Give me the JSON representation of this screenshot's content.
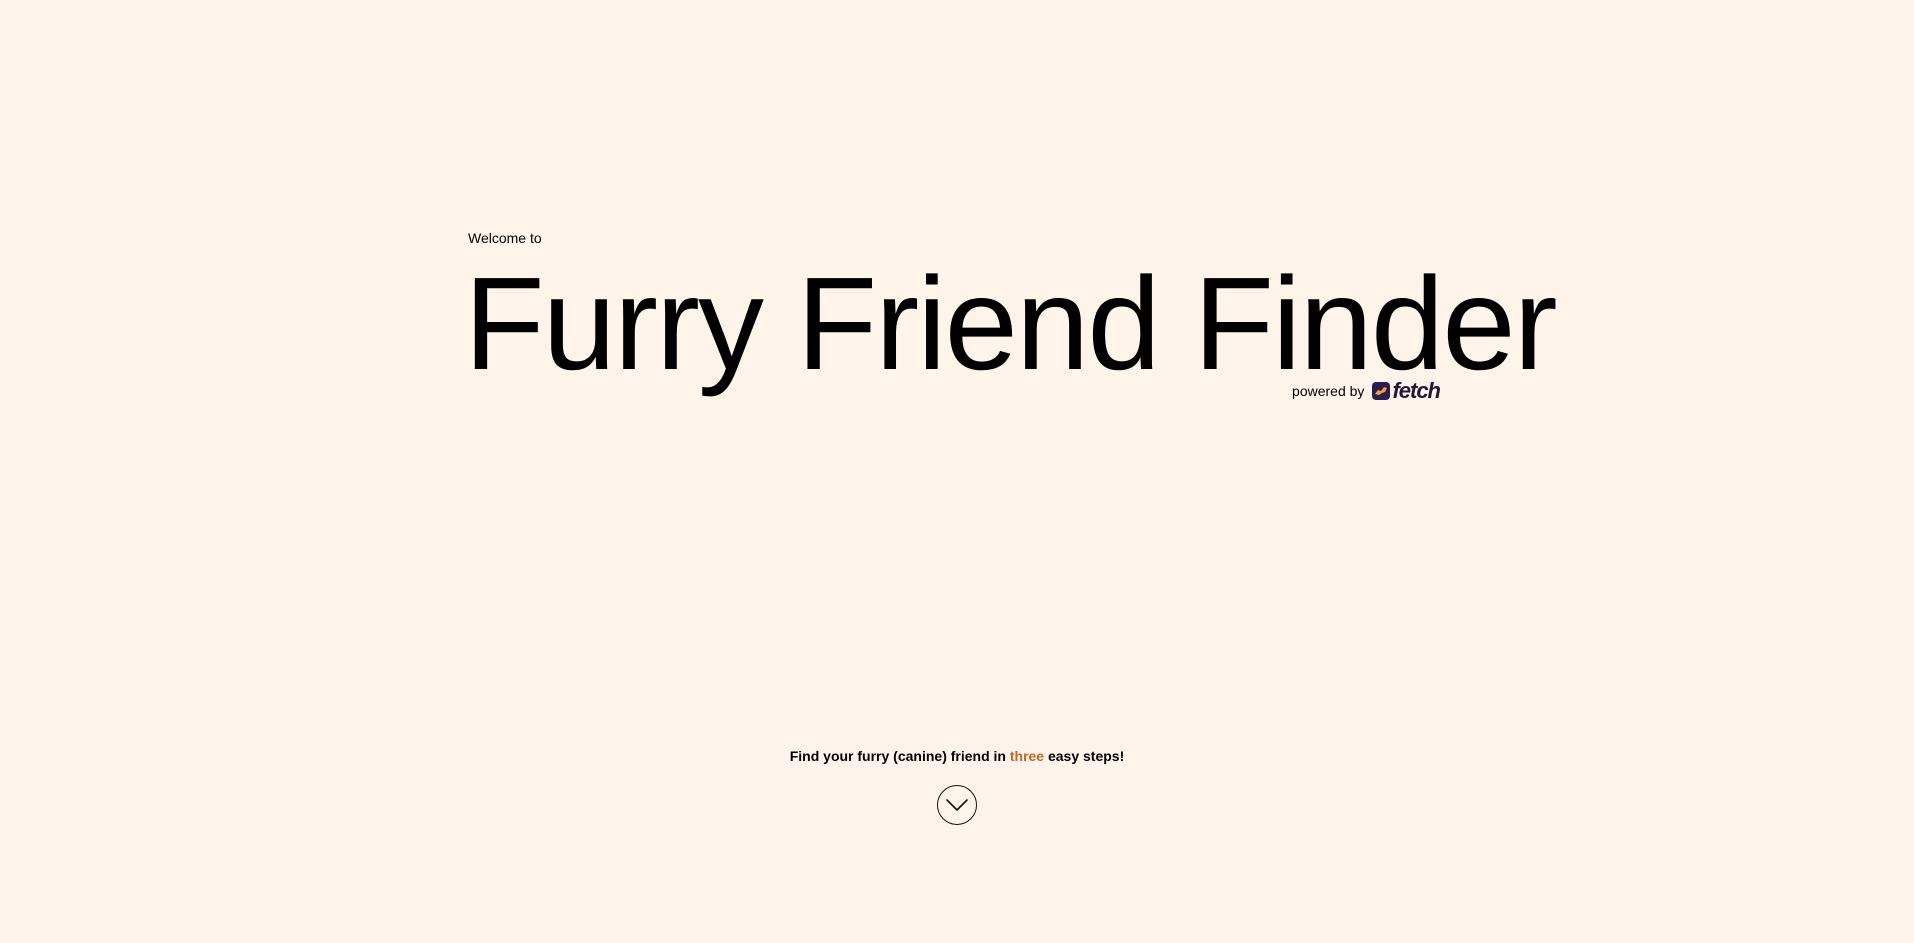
{
  "hero": {
    "welcome": "Welcome to",
    "title": "Furry Friend Finder",
    "powered_by": "powered by",
    "brand": "fetch"
  },
  "cta": {
    "prefix": "Find your furry (canine) friend in ",
    "highlight": "three",
    "suffix": " easy steps!"
  },
  "scroll_button": {
    "icon": "chevron-down-icon"
  },
  "colors": {
    "background": "#fff4ea",
    "accent": "#c8642a",
    "brand": "#2d1d4e"
  }
}
